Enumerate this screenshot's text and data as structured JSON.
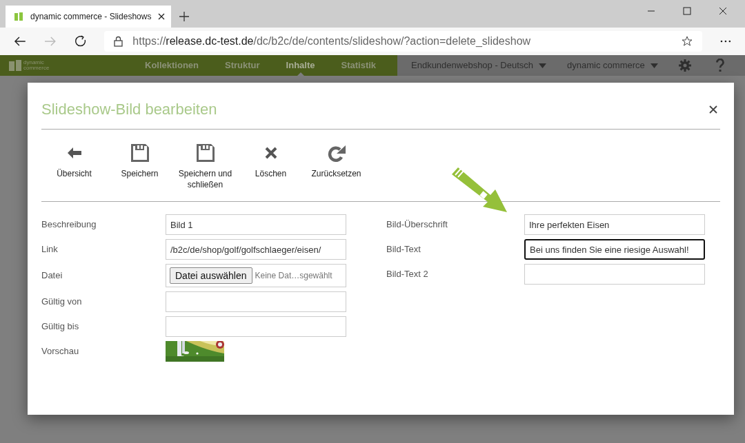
{
  "browser": {
    "tab_title": "dynamic commerce - Slideshows",
    "url_scheme": "https://",
    "url_host": "release.dc-test.de",
    "url_path": "/dc/b2c/de/contents/slideshow/?action=delete_slideshow"
  },
  "app_bar": {
    "logo_line_1": "dynamic",
    "logo_line_2": "commerce",
    "nav": [
      {
        "label": "Kollektionen",
        "selected": false
      },
      {
        "label": "Struktur",
        "selected": false
      },
      {
        "label": "Inhalte",
        "selected": true
      },
      {
        "label": "Statistik",
        "selected": false
      }
    ],
    "selectors": [
      "Endkundenwebshop - Deutsch",
      "dynamic commerce"
    ]
  },
  "dialog": {
    "title": "Slideshow-Bild bearbeiten",
    "toolbar": [
      {
        "kind": "back",
        "label": "Übersicht"
      },
      {
        "kind": "save",
        "label": "Speichern"
      },
      {
        "kind": "save",
        "label": "Speichern und schließen"
      },
      {
        "kind": "delete",
        "label": "Löschen"
      },
      {
        "kind": "reset",
        "label": "Zurücksetzen"
      }
    ],
    "fields_left": [
      {
        "kind": "text",
        "label": "Beschreibung",
        "value": "Bild 1"
      },
      {
        "kind": "text",
        "label": "Link",
        "value": "/b2c/de/shop/golf/golfschlaeger/eisen/"
      },
      {
        "kind": "file",
        "label": "Datei",
        "button": "Datei auswählen",
        "status": "Keine Dat…sgewählt"
      },
      {
        "kind": "text",
        "label": "Gültig von"
      },
      {
        "kind": "text",
        "label": "Gültig bis"
      },
      {
        "kind": "picture",
        "label": "Vorschau"
      }
    ],
    "fields_right": [
      {
        "label": "Bild-Überschrift",
        "value": "Ihre perfekten Eisen",
        "focused": false
      },
      {
        "label": "Bild-Text",
        "value": "Bei uns finden Sie eine riesige Auswahl!",
        "focused": true
      },
      {
        "label": "Bild-Text 2",
        "focused": false
      }
    ]
  }
}
